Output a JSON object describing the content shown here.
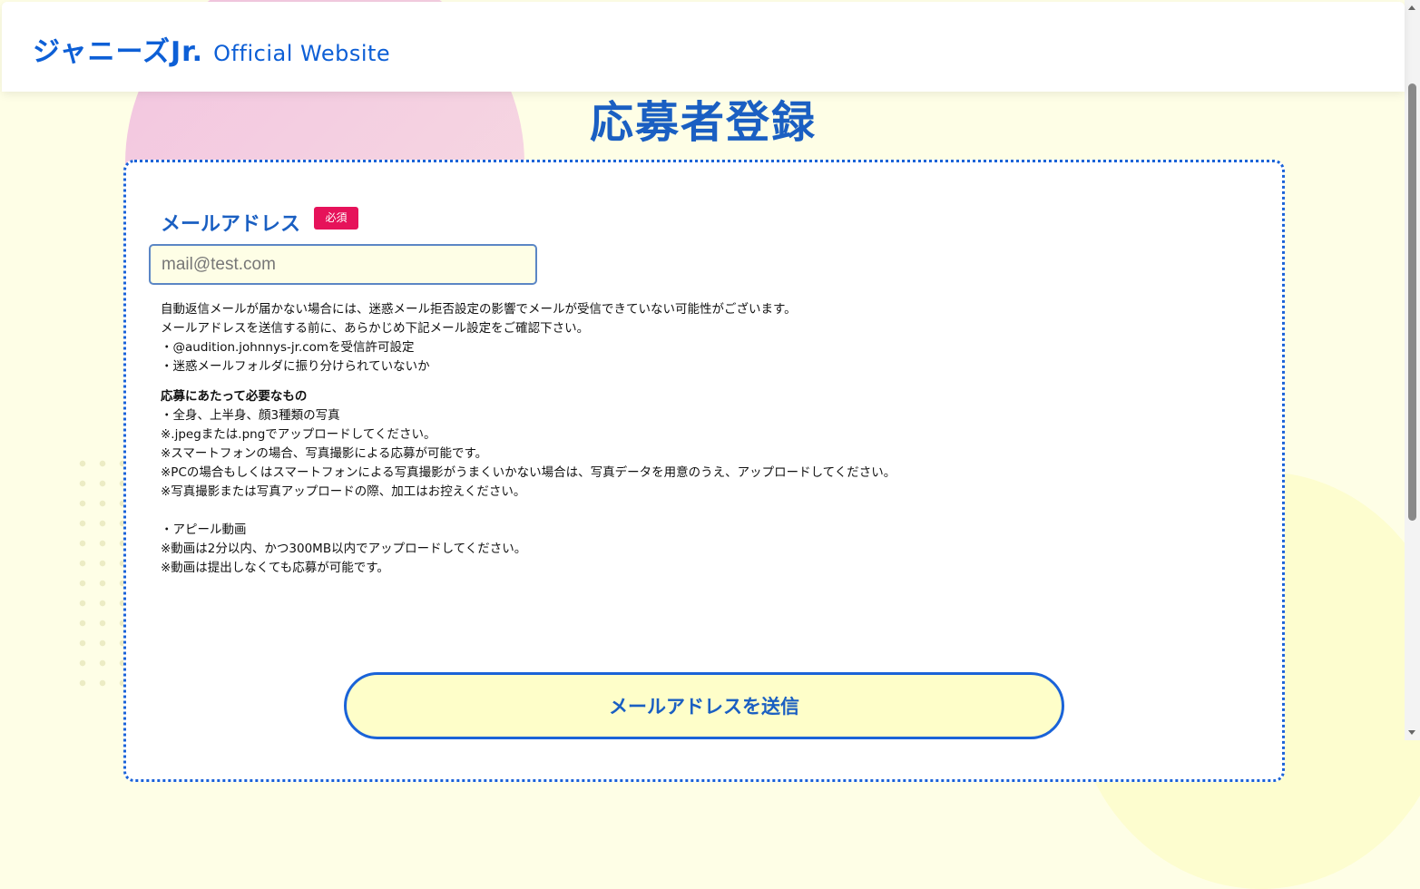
{
  "header": {
    "logo_main": "ジャニーズJr.",
    "logo_sub": "Official Website"
  },
  "page": {
    "title": "応募者登録"
  },
  "form": {
    "email_label": "メールアドレス",
    "required_badge": "必須",
    "email_placeholder": "mail@test.com",
    "email_value": "",
    "notes": [
      "自動返信メールが届かない場合には、迷惑メール拒否設定の影響でメールが受信できていない可能性がございます。",
      "メールアドレスを送信する前に、あらかじめ下記メール設定をご確認下さい。",
      "・@audition.johnnys-jr.comを受信許可設定",
      "・迷惑メールフォルダに振り分けられていないか"
    ],
    "requirements_heading": "応募にあたって必要なもの",
    "requirements": [
      "・全身、上半身、顔3種類の写真",
      "※.jpegまたは.pngでアップロードしてください。",
      "※スマートフォンの場合、写真撮影による応募が可能です。",
      "※PCの場合もしくはスマートフォンによる写真撮影がうまくいかない場合は、写真データを用意のうえ、アップロードしてください。",
      "※写真撮影または写真アップロードの際、加工はお控えください。"
    ],
    "video_requirements": [
      "・アピール動画",
      "※動画は2分以内、かつ300MB以内でアップロードしてください。",
      "※動画は提出しなくても応募が可能です。"
    ],
    "submit_label": "メールアドレスを送信"
  }
}
